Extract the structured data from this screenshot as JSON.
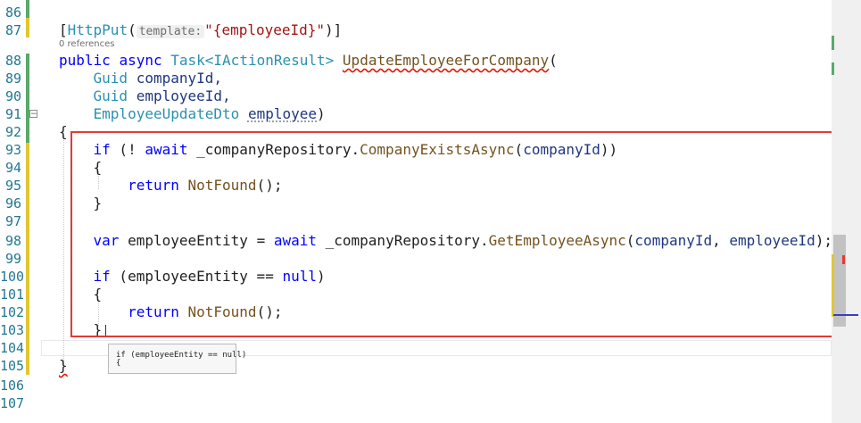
{
  "line_numbers": [
    "86",
    "87",
    "88",
    "89",
    "90",
    "91",
    "92",
    "93",
    "94",
    "95",
    "96",
    "97",
    "98",
    "99",
    "100",
    "101",
    "102",
    "103",
    "104",
    "105",
    "106",
    "107"
  ],
  "code": {
    "attr_open": "[",
    "attr_name": "HttpPut",
    "attr_paren": "(",
    "hint_template": "template:",
    "attr_value": "\"{employeeId}\"",
    "attr_close": ")]",
    "codelens": "0 references",
    "sig_public": "public",
    "sig_async": "async",
    "sig_task": "Task",
    "sig_iaction": "<IActionResult>",
    "sig_method": "UpdateEmployeeForCompany",
    "sig_paren": "(",
    "p1_type": "Guid",
    "p1_name": "companyId,",
    "p2_type": "Guid",
    "p2_name": "employeeId,",
    "p3_type": "EmployeeUpdateDto",
    "p3_name": "employee",
    "p3_close": ")",
    "brace_open": "{",
    "if1_kw": "if",
    "if1_open": " (! ",
    "if1_await": "await",
    "if1_obj": " _companyRepository.",
    "if1_method": "CompanyExistsAsync",
    "if1_paren": "(",
    "if1_arg": "companyId",
    "if1_close": "))",
    "inner_open1": "{",
    "ret1_kw": "return",
    "ret1_method": " NotFound",
    "ret1_tail": "();",
    "inner_close1": "}",
    "var_kw": "var",
    "var_name": " employeeEntity = ",
    "var_await": "await",
    "var_obj": " _companyRepository.",
    "var_method": "GetEmployeeAsync",
    "var_paren": "(",
    "var_arg1": "companyId",
    "var_comma": ", ",
    "var_arg2": "employeeId",
    "var_close": ");",
    "if2_kw": "if",
    "if2_open": " (",
    "if2_var": "employeeEntity",
    "if2_eq": " == ",
    "if2_null": "null",
    "if2_close": ")",
    "inner_open2": "{",
    "ret2_kw": "return",
    "ret2_method": " NotFound",
    "ret2_tail": "();",
    "inner_close2": "}",
    "brace_close": "}"
  },
  "tooltip": {
    "line1": "if (employeeEntity == null)",
    "line2": "{"
  },
  "collapse_symbol": "−",
  "colors": {
    "highlight_box": "#e53935",
    "change_bar_green": "#5aa96a",
    "change_bar_yellow": "#e2c630"
  }
}
